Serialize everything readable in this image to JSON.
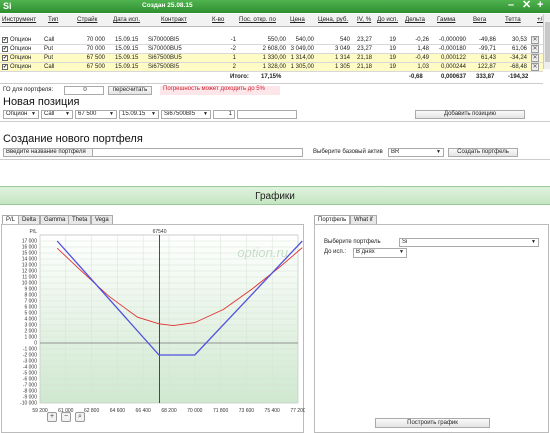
{
  "titlebar": {
    "app": "Si",
    "created": "Создан 25.08.15",
    "controls": [
      "–",
      "✕",
      "+"
    ]
  },
  "columns": [
    "Инструмент",
    "Тип",
    "Страйк",
    "Дата исп.",
    "Контракт",
    "К-во",
    "Пос. откр. по",
    "Цена",
    "Цена, руб.",
    "IV, %",
    "До исп.",
    "Дельта",
    "Гамма",
    "Вега",
    "Тетта",
    "+/-"
  ],
  "rows": [
    {
      "style": "white",
      "checked": true,
      "instrument": "Опцион",
      "type": "Call",
      "strike": "70 000",
      "date": "15.09.15",
      "contract": "Si70000BI5",
      "qty": "-1",
      "open": "550,00",
      "price": "540,00",
      "price_rub": "540",
      "iv": "23,27",
      "days": "19",
      "delta": "-0,26",
      "gamma": "-0,000090",
      "vega": "-49,86",
      "theta": "30,53"
    },
    {
      "style": "white",
      "checked": true,
      "instrument": "Опцион",
      "type": "Put",
      "strike": "70 000",
      "date": "15.09.15",
      "contract": "Si70000BU5",
      "qty": "-2",
      "open": "2 608,00",
      "price": "3 049,00",
      "price_rub": "3 049",
      "iv": "23,27",
      "days": "19",
      "delta": "1,48",
      "gamma": "-0,000180",
      "vega": "-99,71",
      "theta": "61,06"
    },
    {
      "style": "yellow",
      "checked": true,
      "instrument": "Опцион",
      "type": "Put",
      "strike": "67 500",
      "date": "15.09.15",
      "contract": "Si67500BU5",
      "qty": "1",
      "open": "1 330,00",
      "price": "1 314,00",
      "price_rub": "1 314",
      "iv": "21,18",
      "days": "19",
      "delta": "-0,49",
      "gamma": "0,000122",
      "vega": "61,43",
      "theta": "-34,24"
    },
    {
      "style": "yellow",
      "checked": true,
      "instrument": "Опцион",
      "type": "Call",
      "strike": "67 500",
      "date": "15.09.15",
      "contract": "Si67500BI5",
      "qty": "2",
      "open": "1 328,00",
      "price": "1 305,00",
      "price_rub": "1 305",
      "iv": "21,18",
      "days": "19",
      "delta": "1,03",
      "gamma": "0,000244",
      "vega": "122,87",
      "theta": "-68,48"
    }
  ],
  "totals": {
    "label": "Итого:",
    "iv": "17,15%",
    "delta": "-0,68",
    "gamma": "0,000637",
    "vega": "333,87",
    "theta": "-194,32"
  },
  "go": {
    "label": "ГО для портфеля:",
    "value": "0",
    "recalc": "пересчитать",
    "warning": "Погрешность может доходить до 5%"
  },
  "new_position": {
    "title": "Новая позиция",
    "instrument": "Опцион",
    "type": "Call",
    "strike": "67 500",
    "date": "15.09.15",
    "contract": "Si67500BI5",
    "qty": "1",
    "add_button": "Добавить позицию"
  },
  "new_portfolio": {
    "title": "Создание нового портфеля",
    "name_label": "Введите название портфеля",
    "asset_label": "Выберите базовый актив",
    "asset_value": "BR",
    "create_button": "Создать портфель"
  },
  "charts": {
    "header": "Графики",
    "tabs": [
      "P/L",
      "Delta",
      "Gamma",
      "Theta",
      "Vega"
    ],
    "active_tab": "P/L",
    "watermark": "option.ru",
    "marker_label": "67540",
    "yaxis_label": "P/L"
  },
  "panel": {
    "tabs": [
      "Портфель",
      "What if"
    ],
    "portfolio_label": "Выберите портфель",
    "portfolio_value": "Si",
    "expiry_label": "До исп.:",
    "expiry_value": "В днях",
    "build_button": "Построить график"
  },
  "chart_data": {
    "type": "line",
    "x_ticks": [
      59200,
      61000,
      62800,
      64600,
      66400,
      68200,
      70000,
      71800,
      73600,
      75400,
      77200
    ],
    "x_tick_labels": [
      "59 200",
      "61 000",
      "62 800",
      "64 600",
      "66 400",
      "68 200",
      "70 000",
      "71 800",
      "73 600",
      "75 400",
      "77 200"
    ],
    "y_ticks": [
      17000,
      16000,
      15000,
      14000,
      13000,
      12000,
      11000,
      10000,
      9000,
      8000,
      7000,
      6000,
      5000,
      4000,
      3000,
      2000,
      1000,
      0,
      -1000,
      -2000,
      -3000,
      -4000,
      -5000,
      -6000,
      -7000,
      -8000,
      -9000,
      -10000
    ],
    "y_tick_labels": [
      "17 000",
      "16 000",
      "15 000",
      "14 000",
      "13 000",
      "12 000",
      "11 000",
      "10 000",
      "9 000",
      "8 000",
      "7 000",
      "6 000",
      "5 000",
      "4 000",
      "3 000",
      "2 000",
      "1 000",
      "0",
      "-1 000",
      "-2 000",
      "-3 000",
      "-4 000",
      "-5 000",
      "-6 000",
      "-7 000",
      "-8 000",
      "-9 000",
      "-10 000"
    ],
    "xlim": [
      59200,
      77200
    ],
    "ylim": [
      -10000,
      18000
    ],
    "marker_x": 67540,
    "series": [
      {
        "color": "#e03030",
        "x": [
          60400,
          62000,
          64000,
          66000,
          67500,
          68500,
          70000,
          72000,
          74000,
          76000,
          77500
        ],
        "y": [
          15800,
          12200,
          7800,
          4300,
          3200,
          2900,
          3400,
          5600,
          9000,
          12800,
          15900
        ]
      },
      {
        "color": "#5050e0",
        "x": [
          60400,
          67500,
          70000,
          77500
        ],
        "y": [
          17000,
          -2000,
          -2000,
          17000
        ]
      }
    ]
  }
}
